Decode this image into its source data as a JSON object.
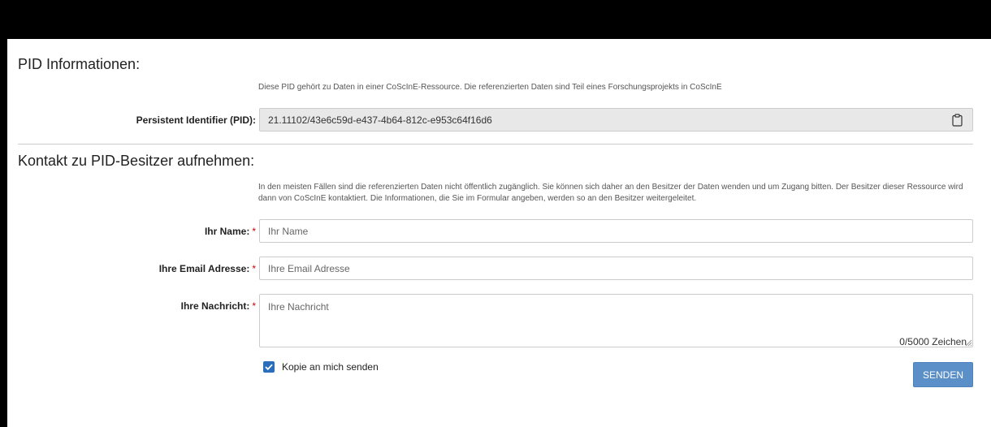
{
  "pid_section": {
    "title": "PID Informationen:",
    "help": "Diese PID gehört zu Daten in einer CoScInE-Ressource. Die referenzierten Daten sind Teil eines Forschungsprojekts in CoScInE",
    "pid_label": "Persistent Identifier (PID):",
    "pid_value": "21.11102/43e6c59d-e437-4b64-812c-e953c64f16d6",
    "copy_icon": "clipboard-icon"
  },
  "contact_section": {
    "title": "Kontakt zu PID-Besitzer aufnehmen:",
    "help": "In den meisten Fällen sind die referenzierten Daten nicht öffentlich zugänglich. Sie können sich daher an den Besitzer der Daten wenden und um Zugang bitten. Der Besitzer dieser Ressource wird dann von CoScInE kontaktiert. Die Informationen, die Sie im Formular angeben, werden so an den Besitzer weitergeleitet.",
    "required_mark": "*",
    "name": {
      "label": "Ihr Name:",
      "placeholder": "Ihr Name",
      "value": ""
    },
    "email": {
      "label": "Ihre Email Adresse:",
      "placeholder": "Ihre Email Adresse",
      "value": ""
    },
    "message": {
      "label": "Ihre Nachricht:",
      "placeholder": "Ihre Nachricht",
      "value": "",
      "counter": "0/5000 Zeichen"
    },
    "copy_checkbox": {
      "label": "Kopie an mich senden",
      "checked": true
    },
    "send_button": "SENDEN"
  },
  "colors": {
    "primary": "#5b8fc7",
    "checkbox": "#2a6ebb",
    "required": "#cc0000"
  }
}
